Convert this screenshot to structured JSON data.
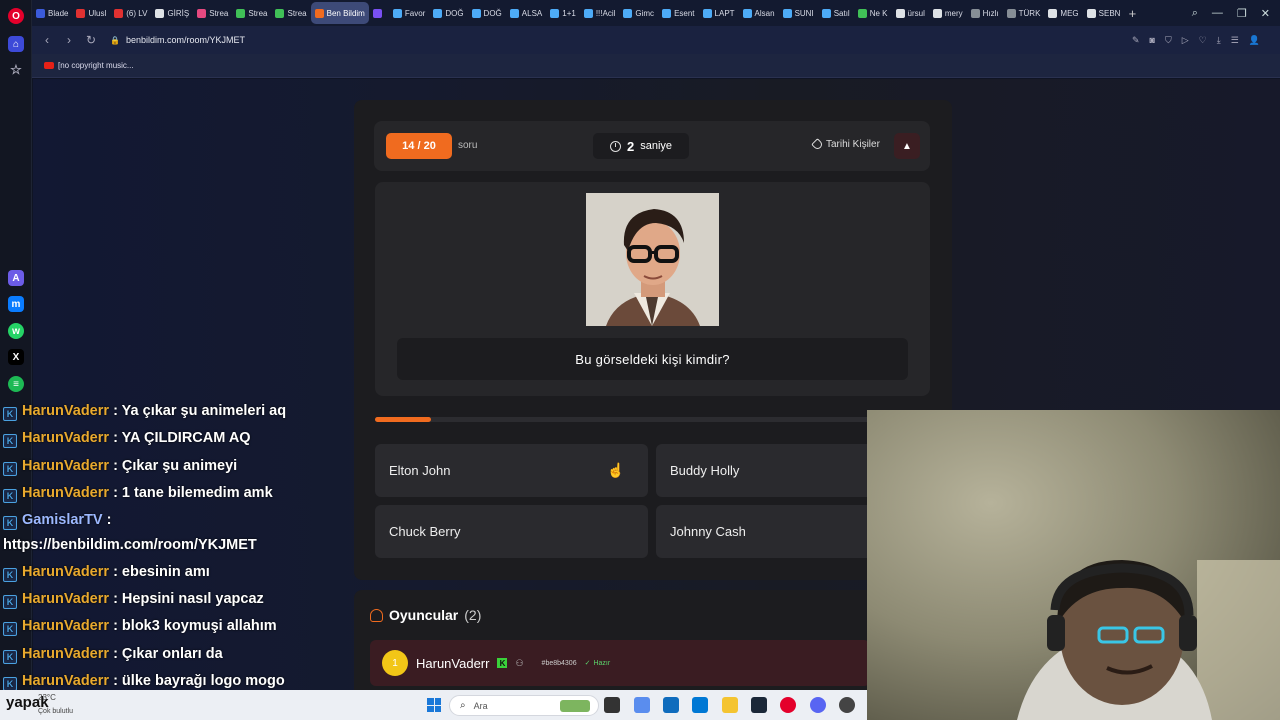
{
  "browser": {
    "tabs": [
      {
        "label": "Blade",
        "color": "#3b5bdb"
      },
      {
        "label": "Ulusl",
        "color": "#e03131"
      },
      {
        "label": "(6) LV",
        "color": "#e03131"
      },
      {
        "label": "GİRİŞ",
        "color": "#dee2e6"
      },
      {
        "label": "Strea",
        "color": "#e64980"
      },
      {
        "label": "Strea",
        "color": "#40c057"
      },
      {
        "label": "Strea",
        "color": "#40c057"
      },
      {
        "label": "Ben Bildim",
        "color": "#f06b1f"
      },
      {
        "label": "",
        "color": "#7950f2"
      },
      {
        "label": "Favor",
        "color": "#4dabf7"
      },
      {
        "label": "DOĞ",
        "color": "#4dabf7"
      },
      {
        "label": "DOĞ",
        "color": "#4dabf7"
      },
      {
        "label": "ALSA",
        "color": "#4dabf7"
      },
      {
        "label": "1+1",
        "color": "#4dabf7"
      },
      {
        "label": "!!!Acil",
        "color": "#4dabf7"
      },
      {
        "label": "Gimc",
        "color": "#4dabf7"
      },
      {
        "label": "Esent",
        "color": "#4dabf7"
      },
      {
        "label": "LAPT",
        "color": "#4dabf7"
      },
      {
        "label": "Alsan",
        "color": "#4dabf7"
      },
      {
        "label": "SUNI",
        "color": "#4dabf7"
      },
      {
        "label": "Satıl",
        "color": "#4dabf7"
      },
      {
        "label": "Ne K",
        "color": "#40c057"
      },
      {
        "label": "ürsul",
        "color": "#dee2e6"
      },
      {
        "label": "mery",
        "color": "#dee2e6"
      },
      {
        "label": "Hızlı",
        "color": "#868e96"
      },
      {
        "label": "TÜRK",
        "color": "#868e96"
      },
      {
        "label": "MEG",
        "color": "#dee2e6"
      },
      {
        "label": "SEBN",
        "color": "#dee2e6"
      }
    ],
    "active_tab_index": 7,
    "url": "benbildim.com/room/YKJMET",
    "bookmark": "[no copyright music..."
  },
  "quiz": {
    "question_counter": "14 / 20",
    "question_word": "soru",
    "timer_value": "2",
    "timer_unit": "saniye",
    "category": "Tarihi Kişiler",
    "report_icon": "warning-icon",
    "question": "Bu görseldeki kişi kimdir?",
    "progress": 0.1,
    "answers": [
      "Elton John",
      "Buddy Holly",
      "Chuck Berry",
      "Johnny Cash"
    ]
  },
  "players": {
    "title": "Oyuncular",
    "count": "(2)",
    "list": [
      {
        "initial": "1",
        "name": "HarunVaderr",
        "color_code": "#be8b4306",
        "status": "Hazır"
      }
    ]
  },
  "chat": [
    {
      "user": "HarunVaderr",
      "text": ": Ya çıkar şu animeleri aq",
      "user_color": "#e8a92e"
    },
    {
      "user": "HarunVaderr",
      "text": ": YA ÇILDIRCAM AQ",
      "user_color": "#e8a92e"
    },
    {
      "user": "HarunVaderr",
      "text": ": Çıkar şu animeyi",
      "user_color": "#e8a92e"
    },
    {
      "user": "HarunVaderr",
      "text": ": 1 tane bilemedim amk",
      "user_color": "#e8a92e"
    },
    {
      "user": "GamislarTV",
      "text": ":",
      "user_color": "#9cb8ff"
    },
    {
      "user": "",
      "text": "https://benbildim.com/room/YKJMET",
      "user_color": "#ffffff"
    },
    {
      "user": "HarunVaderr",
      "text": ": ebesinin amı",
      "user_color": "#e8a92e"
    },
    {
      "user": "HarunVaderr",
      "text": ": Hepsini nasıl yapcaz",
      "user_color": "#e8a92e"
    },
    {
      "user": "HarunVaderr",
      "text": ": blok3 koymuşi allahım",
      "user_color": "#e8a92e"
    },
    {
      "user": "HarunVaderr",
      "text": ": Çıkar onları da",
      "user_color": "#e8a92e"
    },
    {
      "user": "HarunVaderr",
      "text": ": ülke bayrağı logo mogo",
      "user_color": "#e8a92e"
    }
  ],
  "taskbar": {
    "overlay_name": "yapak",
    "weather": "23°C",
    "weather_desc": "Çok bulutlu",
    "search_placeholder": "Ara"
  }
}
